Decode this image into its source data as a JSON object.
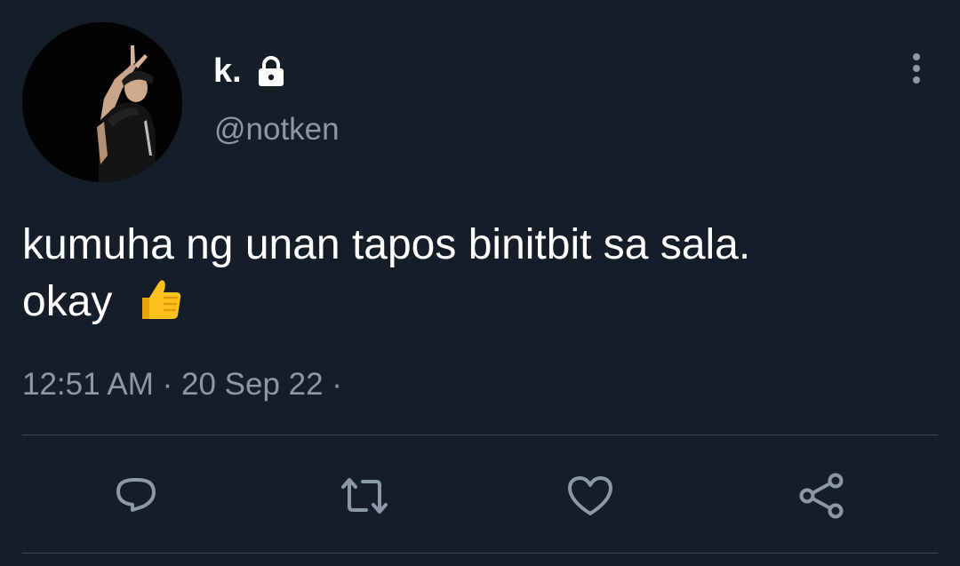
{
  "tweet": {
    "display_name": "k.",
    "handle": "@notken",
    "protected_account": true,
    "text_line1": "kumuha ng unan tapos binitbit sa sala.",
    "text_line2": "okay",
    "emoji": "thumbs-up-icon",
    "timestamp": "12:51 AM · 20 Sep 22 ·"
  },
  "actions": {
    "reply": "reply-icon",
    "retweet": "retweet-icon",
    "like": "like-icon",
    "share": "share-icon"
  },
  "theme": {
    "background": "#151d29",
    "text_primary": "#ffffff",
    "text_secondary": "#8b98a5",
    "icon_color": "#8b98a5",
    "divider": "#38444d"
  }
}
